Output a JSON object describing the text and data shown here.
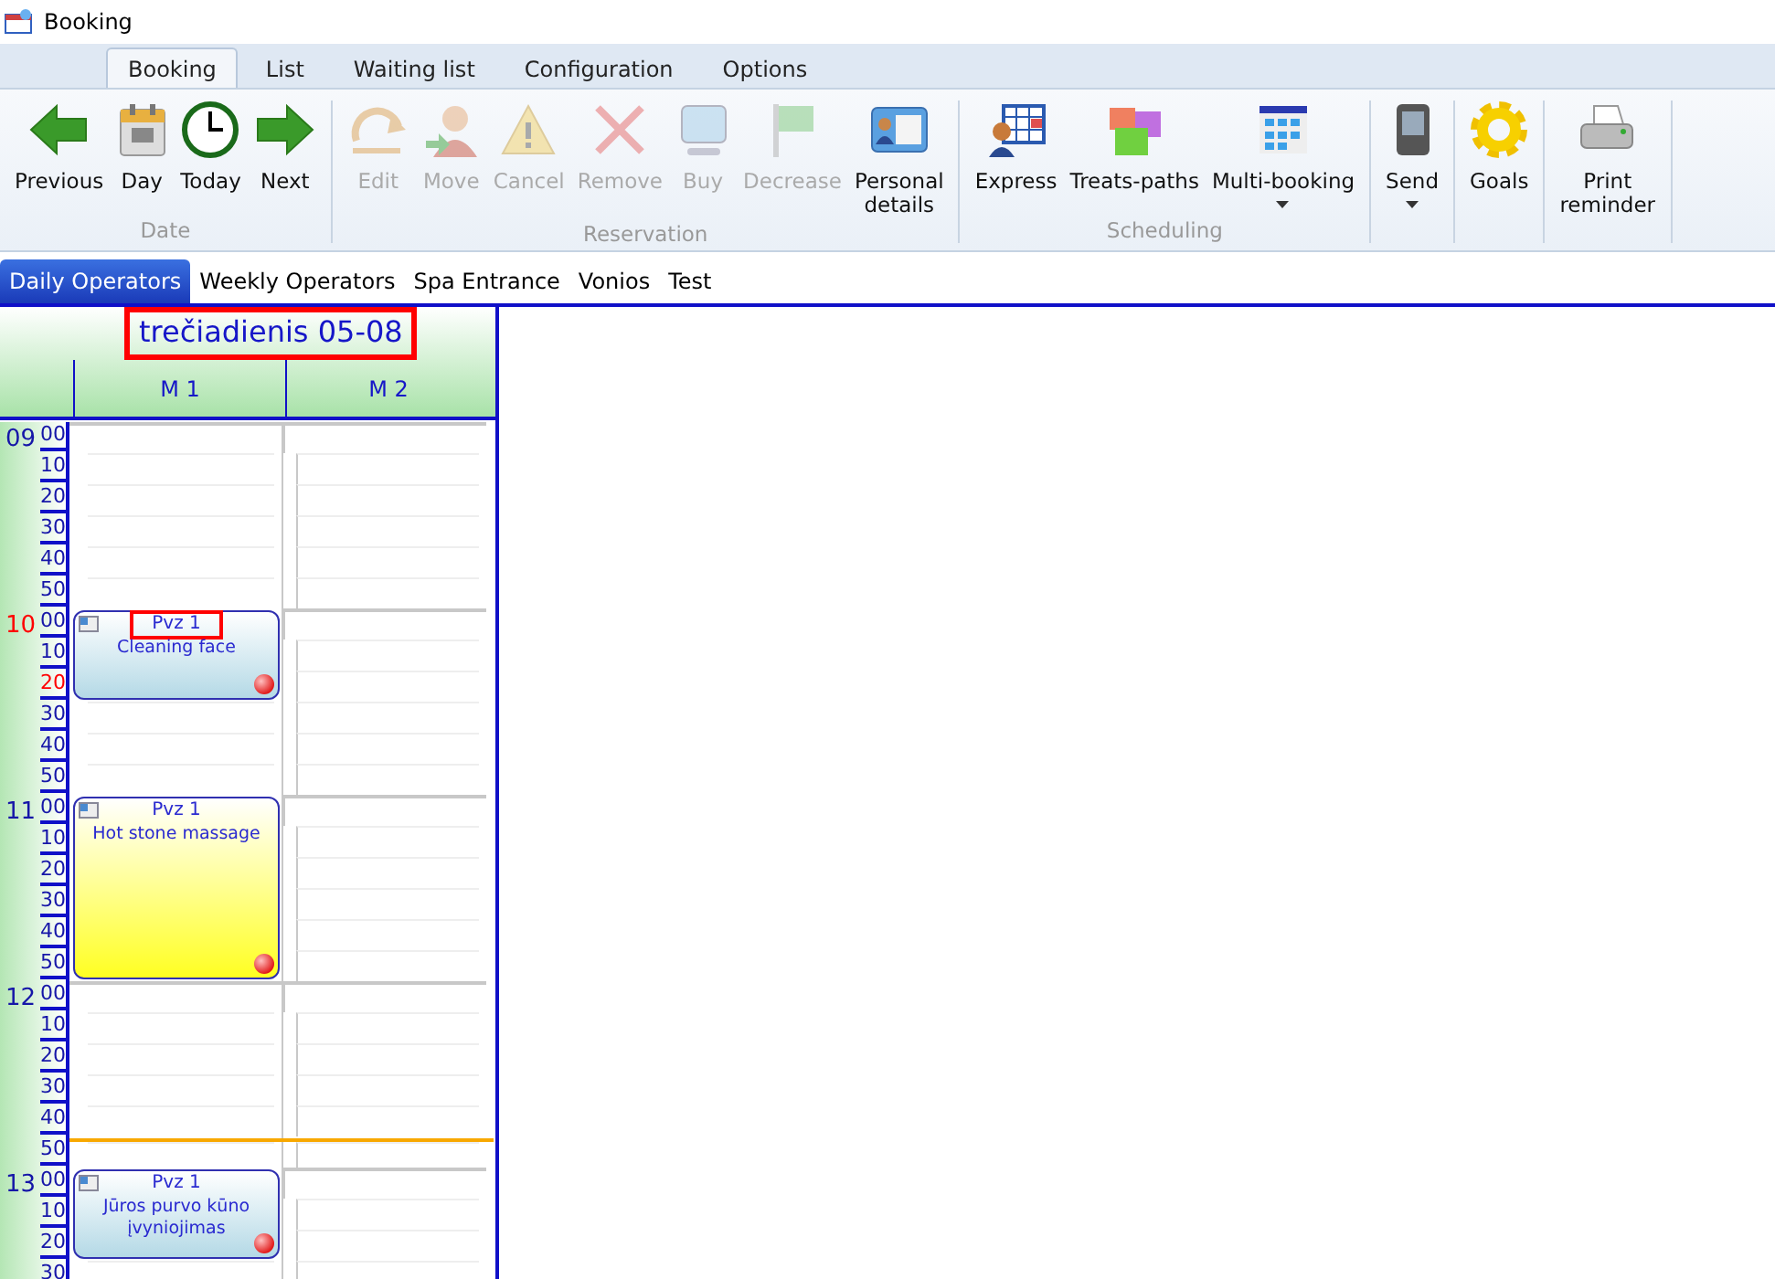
{
  "window": {
    "title": "Booking"
  },
  "ribbon": {
    "tabs": [
      {
        "label": "Booking",
        "selected": true
      },
      {
        "label": "List",
        "selected": false
      },
      {
        "label": "Waiting list",
        "selected": false
      },
      {
        "label": "Configuration",
        "selected": false
      },
      {
        "label": "Options",
        "selected": false
      }
    ],
    "groups": [
      {
        "label": "Date",
        "buttons": [
          {
            "kind": "back",
            "label": "Previous",
            "disabled": false,
            "dropdown": false
          },
          {
            "kind": "calendar",
            "label": "Day",
            "disabled": false,
            "dropdown": false
          },
          {
            "kind": "clock",
            "label": "Today",
            "disabled": false,
            "dropdown": false
          },
          {
            "kind": "forward",
            "label": "Next",
            "disabled": false,
            "dropdown": false
          }
        ]
      },
      {
        "label": "Reservation",
        "buttons": [
          {
            "kind": "undo",
            "label": "Edit",
            "disabled": true,
            "dropdown": false
          },
          {
            "kind": "person",
            "label": "Move",
            "disabled": true,
            "dropdown": false
          },
          {
            "kind": "warning",
            "label": "Cancel",
            "disabled": true,
            "dropdown": false
          },
          {
            "kind": "cross",
            "label": "Remove",
            "disabled": true,
            "dropdown": false
          },
          {
            "kind": "monitor",
            "label": "Buy",
            "disabled": true,
            "dropdown": false
          },
          {
            "kind": "flag",
            "label": "Decrease",
            "disabled": true,
            "dropdown": false
          },
          {
            "kind": "card",
            "label": "Personal\ndetails",
            "disabled": false,
            "dropdown": false
          }
        ]
      },
      {
        "label": "Scheduling",
        "buttons": [
          {
            "kind": "schedule",
            "label": "Express",
            "disabled": false,
            "dropdown": false
          },
          {
            "kind": "cubes",
            "label": "Treats-paths",
            "disabled": false,
            "dropdown": false
          },
          {
            "kind": "grid",
            "label": "Multi-booking",
            "disabled": false,
            "dropdown": true
          }
        ]
      },
      {
        "buttons": [
          {
            "kind": "phone",
            "label": "Send",
            "disabled": false,
            "dropdown": true
          }
        ]
      },
      {
        "buttons": [
          {
            "kind": "gear",
            "label": "Goals",
            "disabled": false,
            "dropdown": false
          }
        ]
      },
      {
        "buttons": [
          {
            "kind": "printer",
            "label": "Print\nreminder",
            "disabled": false,
            "dropdown": false
          }
        ]
      }
    ]
  },
  "view_tabs": [
    {
      "label": "Daily Operators",
      "selected": true
    },
    {
      "label": "Weekly Operators",
      "selected": false
    },
    {
      "label": "Spa Entrance",
      "selected": false
    },
    {
      "label": "Vonios",
      "selected": false
    },
    {
      "label": "Test",
      "selected": false
    }
  ],
  "calendar": {
    "date": "trečiadienis 05-08",
    "date_highlighted": true,
    "columns": [
      "M 1",
      "M 2"
    ],
    "hours": [
      {
        "label": "09",
        "alert": false,
        "slots": [
          {
            "kind": "plain",
            "label": "00",
            "alert": false,
            "cells": [
              {
                "kind": "free"
              },
              {
                "kind": "free"
              }
            ]
          },
          {
            "kind": "plain",
            "label": "10",
            "alert": false,
            "cells": [
              {
                "kind": "free"
              },
              {
                "kind": "free"
              }
            ]
          },
          {
            "kind": "plain",
            "label": "20",
            "alert": false,
            "cells": [
              {
                "kind": "free"
              },
              {
                "kind": "free"
              }
            ]
          },
          {
            "kind": "plain",
            "label": "30",
            "alert": false,
            "cells": [
              {
                "kind": "free"
              },
              {
                "kind": "free"
              }
            ]
          },
          {
            "kind": "plain",
            "label": "40",
            "alert": false,
            "cells": [
              {
                "kind": "free"
              },
              {
                "kind": "free"
              }
            ]
          },
          {
            "kind": "plain",
            "label": "50",
            "alert": false,
            "cells": [
              {
                "kind": "free"
              },
              {
                "kind": "free"
              }
            ]
          }
        ]
      },
      {
        "label": "10",
        "alert": true,
        "slots": [
          {
            "kind": "plain",
            "label": "00",
            "alert": false,
            "cells": [
              {
                "kind": "booked",
                "booking": {
                  "title": "Pvz 1",
                  "title_highlighted": true,
                  "service": "Cleaning face",
                  "color": "#b4d9e6"
                }
              },
              {
                "kind": "free"
              }
            ]
          },
          {
            "kind": "plain",
            "label": "10",
            "alert": false,
            "cells": [
              {
                "kind": "booked"
              },
              {
                "kind": "free"
              }
            ]
          },
          {
            "kind": "plain",
            "label": "20",
            "alert": true,
            "cells": [
              {
                "kind": "booked"
              },
              {
                "kind": "free"
              }
            ]
          },
          {
            "kind": "plain",
            "label": "30",
            "alert": false,
            "cells": [
              {
                "kind": "free"
              },
              {
                "kind": "free"
              }
            ]
          },
          {
            "kind": "plain",
            "label": "40",
            "alert": false,
            "cells": [
              {
                "kind": "free"
              },
              {
                "kind": "free"
              }
            ]
          },
          {
            "kind": "plain",
            "label": "50",
            "alert": false,
            "cells": [
              {
                "kind": "free"
              },
              {
                "kind": "free"
              }
            ]
          }
        ]
      },
      {
        "label": "11",
        "alert": false,
        "slots": [
          {
            "kind": "plain",
            "label": "00",
            "alert": false,
            "cells": [
              {
                "kind": "booked",
                "booking": {
                  "title": "Pvz 1",
                  "title_highlighted": false,
                  "service": "Hot stone massage",
                  "color": "#ffff22"
                }
              },
              {
                "kind": "free"
              }
            ]
          },
          {
            "kind": "plain",
            "label": "10",
            "alert": false,
            "cells": [
              {
                "kind": "booked"
              },
              {
                "kind": "free"
              }
            ]
          },
          {
            "kind": "plain",
            "label": "20",
            "alert": false,
            "cells": [
              {
                "kind": "booked"
              },
              {
                "kind": "free"
              }
            ]
          },
          {
            "kind": "plain",
            "label": "30",
            "alert": false,
            "cells": [
              {
                "kind": "booked"
              },
              {
                "kind": "free"
              }
            ]
          },
          {
            "kind": "plain",
            "label": "40",
            "alert": false,
            "cells": [
              {
                "kind": "booked"
              },
              {
                "kind": "free"
              }
            ]
          },
          {
            "kind": "plain",
            "label": "50",
            "alert": false,
            "cells": [
              {
                "kind": "booked"
              },
              {
                "kind": "free"
              }
            ]
          }
        ]
      },
      {
        "label": "12",
        "alert": false,
        "slots": [
          {
            "kind": "plain",
            "label": "00",
            "alert": false,
            "cells": [
              {
                "kind": "free"
              },
              {
                "kind": "free"
              }
            ]
          },
          {
            "kind": "plain",
            "label": "10",
            "alert": false,
            "cells": [
              {
                "kind": "free"
              },
              {
                "kind": "free"
              }
            ]
          },
          {
            "kind": "plain",
            "label": "20",
            "alert": false,
            "cells": [
              {
                "kind": "free"
              },
              {
                "kind": "free"
              }
            ]
          },
          {
            "kind": "plain",
            "label": "30",
            "alert": false,
            "cells": [
              {
                "kind": "free"
              },
              {
                "kind": "free"
              }
            ]
          },
          {
            "kind": "plain",
            "label": "40",
            "alert": false,
            "cells": [
              {
                "kind": "free"
              },
              {
                "kind": "free"
              }
            ]
          },
          {
            "kind": "current",
            "label": "50",
            "alert": false,
            "cells": [
              {
                "kind": "free"
              },
              {
                "kind": "free"
              }
            ]
          }
        ]
      },
      {
        "label": "13",
        "alert": false,
        "slots": [
          {
            "kind": "plain",
            "label": "00",
            "alert": false,
            "cells": [
              {
                "kind": "booked",
                "booking": {
                  "title": "Pvz 1",
                  "title_highlighted": false,
                  "service": "Jūros purvo kūno įvyniojimas",
                  "color": "#b4d9e6"
                }
              },
              {
                "kind": "free"
              }
            ]
          },
          {
            "kind": "plain",
            "label": "10",
            "alert": false,
            "cells": [
              {
                "kind": "booked"
              },
              {
                "kind": "free"
              }
            ]
          },
          {
            "kind": "plain",
            "label": "20",
            "alert": false,
            "cells": [
              {
                "kind": "booked"
              },
              {
                "kind": "free"
              }
            ]
          },
          {
            "kind": "plain",
            "label": "30",
            "alert": false,
            "cells": [
              {
                "kind": "free"
              },
              {
                "kind": "free"
              }
            ]
          }
        ]
      }
    ]
  }
}
